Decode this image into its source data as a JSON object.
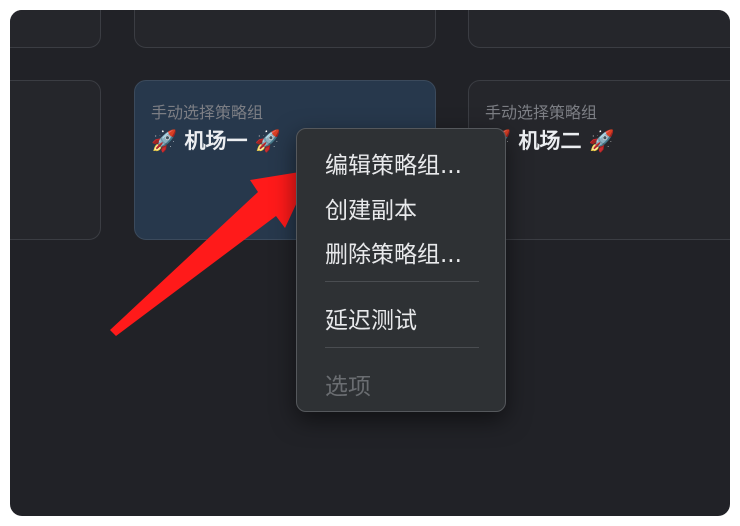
{
  "cards": [
    {
      "subtitle": "",
      "title": ""
    },
    {
      "subtitle": "",
      "title": ""
    },
    {
      "subtitle": "",
      "title": ""
    },
    {
      "subtitle": "",
      "title": ""
    },
    {
      "subtitle": "手动选择策略组",
      "title": "🚀 机场一 🚀"
    },
    {
      "subtitle": "手动选择策略组",
      "title": "🚀 机场二 🚀"
    }
  ],
  "context_menu": {
    "items": [
      {
        "label": "编辑策略组...",
        "enabled": true
      },
      {
        "label": "创建副本",
        "enabled": true
      },
      {
        "label": "删除策略组...",
        "enabled": true
      },
      {
        "label": "延迟测试",
        "enabled": true
      },
      {
        "label": "选项",
        "enabled": false
      }
    ]
  },
  "colors": {
    "window_bg": "#212227",
    "card_bg": "#25262b",
    "selected_card_bg": "#27384c",
    "menu_bg": "#2e3134",
    "arrow": "#ff1a1a"
  },
  "icons": [
    "rocket-emoji"
  ]
}
